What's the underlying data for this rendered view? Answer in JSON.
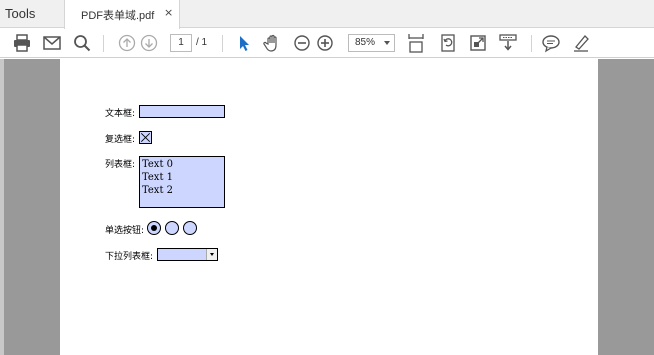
{
  "tabs": {
    "tools_label": "Tools",
    "document_title": "PDF表单域.pdf",
    "close_glyph": "×"
  },
  "toolbar": {
    "icons": [
      "print-icon",
      "email-icon",
      "search-icon",
      "page-up-icon",
      "page-down-icon",
      "select-arrow-icon",
      "hand-icon",
      "zoom-out-icon",
      "zoom-in-icon",
      "fit-page-icon",
      "rotate-icon",
      "full-screen-icon",
      "scroll-mode-icon",
      "comment-icon",
      "sign-icon"
    ],
    "current_page": "1",
    "page_total": "/ 1",
    "zoom_level": "85%",
    "accent_color": "#1a6fc7"
  },
  "form": {
    "textbox_label": "文本框:",
    "checkbox_label": "复选框:",
    "checkbox_checked": true,
    "listbox_label": "列表框:",
    "list_items": [
      "Text 0",
      "Text 1",
      "Text 2"
    ],
    "radio_label": "单选按钮:",
    "radio_selected_index": 0,
    "dropdown_label": "下拉列表框:",
    "field_fill_color": "#cdd6ff"
  }
}
